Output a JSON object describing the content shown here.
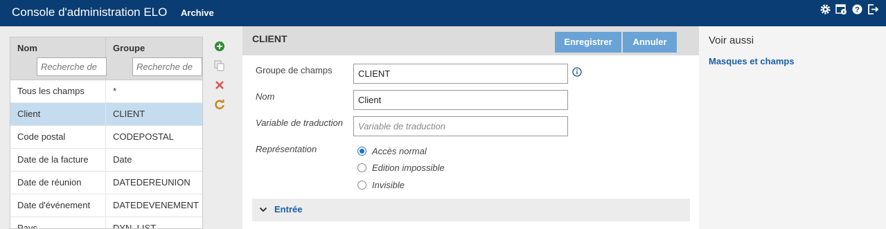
{
  "header": {
    "title": "Console d'administration ELO",
    "subtitle": "Archive",
    "icons": [
      "gear-icon",
      "window-info-icon",
      "help-icon",
      "logout-icon"
    ]
  },
  "grid": {
    "columns": [
      {
        "label": "Nom",
        "filter_placeholder": "Recherche de"
      },
      {
        "label": "Groupe",
        "filter_placeholder": "Recherche de"
      }
    ],
    "rows": [
      {
        "name": "Tous les champs",
        "group": "*"
      },
      {
        "name": "Client",
        "group": "CLIENT"
      },
      {
        "name": "Code postal",
        "group": "CODEPOSTAL"
      },
      {
        "name": "Date de la facture",
        "group": "Date"
      },
      {
        "name": "Date de réunion",
        "group": "DATEDEREUNION"
      },
      {
        "name": "Date d'événement",
        "group": "DATEDEVENEMENT"
      },
      {
        "name": "Pays",
        "group": "DYN_LIST"
      }
    ],
    "selected_index": 1
  },
  "tools": [
    "add-icon",
    "copy-icon",
    "delete-icon",
    "refresh-icon"
  ],
  "editor": {
    "title": "CLIENT",
    "save_label": "Enregistrer",
    "cancel_label": "Annuler",
    "fields": {
      "group_label": "Groupe de champs",
      "group_value": "CLIENT",
      "name_label": "Nom",
      "name_value": "Client",
      "translation_label": "Variable de traduction",
      "translation_placeholder": "Variable de traduction",
      "representation_label": "Représentation"
    },
    "radios": [
      {
        "label": "Accès normal",
        "checked": true
      },
      {
        "label": "Edition impossible",
        "checked": false
      },
      {
        "label": "Invisible",
        "checked": false
      }
    ],
    "section_label": "Entrée"
  },
  "see_also": {
    "title": "Voir aussi",
    "link": "Masques et champs"
  },
  "colors": {
    "header_bg": "#0a3d73",
    "button_bg": "#6aa3d6",
    "selected_row": "#c5dcef",
    "link": "#1a5fa8"
  }
}
